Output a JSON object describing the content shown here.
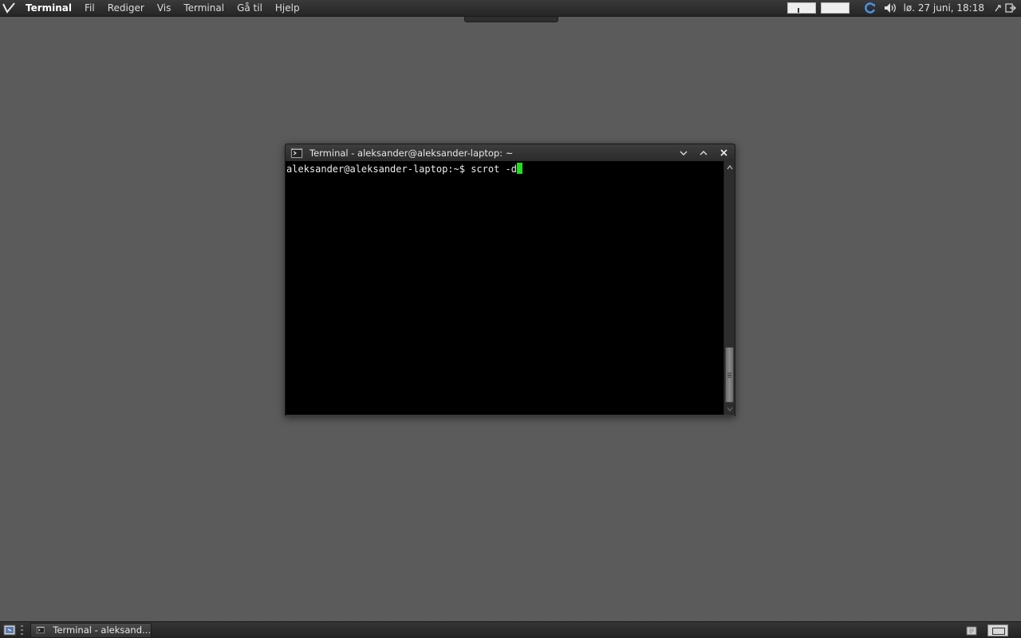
{
  "top_panel": {
    "menu": [
      "Terminal",
      "Fil",
      "Rediger",
      "Vis",
      "Terminal",
      "Gå til",
      "Hjelp"
    ],
    "clock": "lø. 27 juni, 18:18"
  },
  "window": {
    "title": "Terminal - aleksander@aleksander-laptop: ~",
    "prompt": "aleksander@aleksander-laptop:~$ ",
    "command": "scrot -d"
  },
  "bottom_panel": {
    "task_label": "Terminal - aleksand..."
  },
  "colors": {
    "desktop": "#5b5b5b",
    "cursor": "#22dd22",
    "terminal_bg": "#000000"
  }
}
